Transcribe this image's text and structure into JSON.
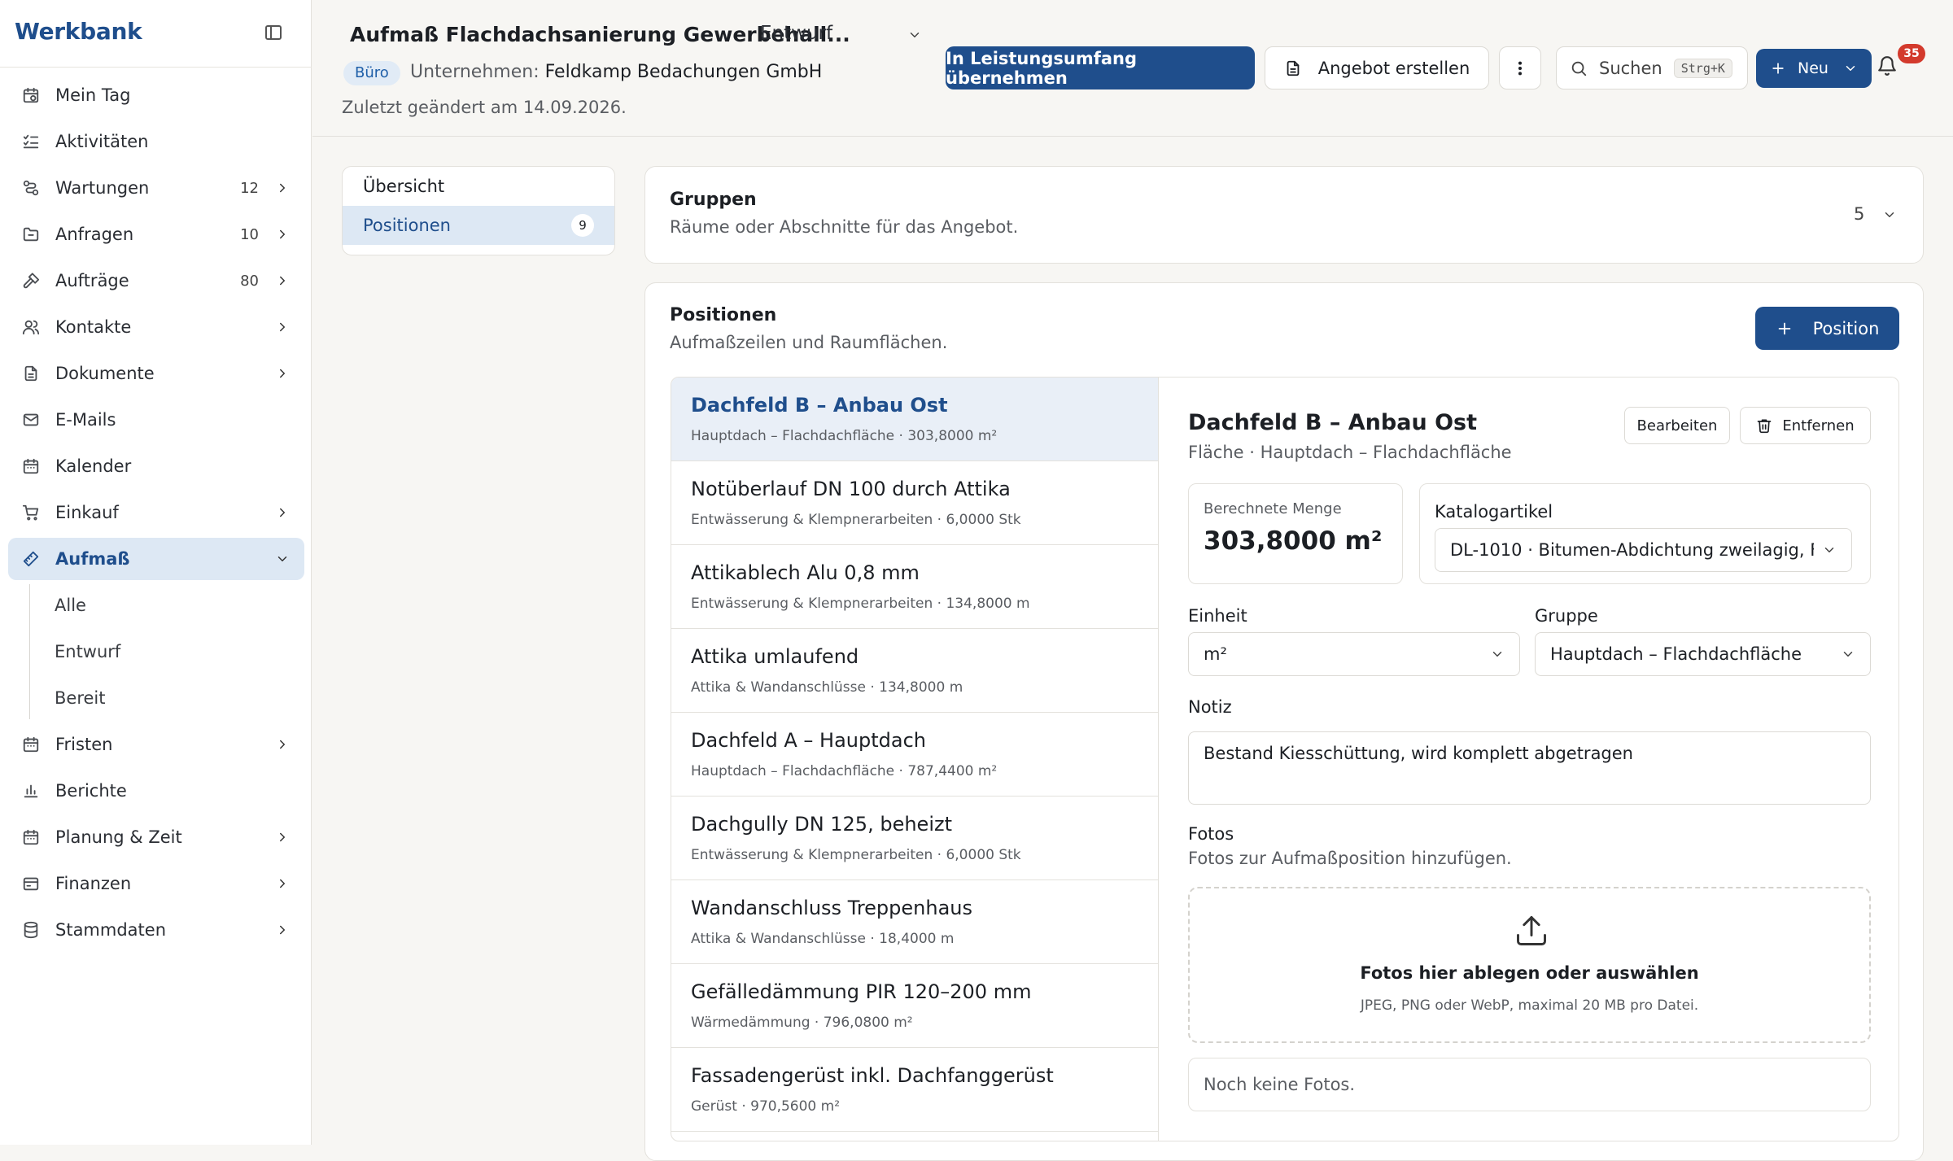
{
  "app": {
    "brand": "Werkbank"
  },
  "sidebar": {
    "items": [
      {
        "label": "Mein Tag",
        "icon": "calendar-clock-icon",
        "count": "",
        "chevron": false
      },
      {
        "label": "Aktivitäten",
        "icon": "list-checks-icon",
        "count": "",
        "chevron": false
      },
      {
        "label": "Wartungen",
        "icon": "route-icon",
        "count": "12",
        "chevron": true
      },
      {
        "label": "Anfragen",
        "icon": "folder-icon",
        "count": "10",
        "chevron": true
      },
      {
        "label": "Aufträge",
        "icon": "hammer-icon",
        "count": "80",
        "chevron": true
      },
      {
        "label": "Kontakte",
        "icon": "users-icon",
        "count": "",
        "chevron": true
      },
      {
        "label": "Dokumente",
        "icon": "document-icon",
        "count": "",
        "chevron": true
      },
      {
        "label": "E-Mails",
        "icon": "mail-icon",
        "count": "",
        "chevron": false
      },
      {
        "label": "Kalender",
        "icon": "calendar-icon",
        "count": "",
        "chevron": false
      },
      {
        "label": "Einkauf",
        "icon": "cart-icon",
        "count": "",
        "chevron": true
      },
      {
        "label": "Aufmaß",
        "icon": "ruler-icon",
        "count": "",
        "chevron": true,
        "active": true
      }
    ],
    "sub_items": [
      {
        "label": "Alle"
      },
      {
        "label": "Entwurf"
      },
      {
        "label": "Bereit"
      }
    ],
    "items_after": [
      {
        "label": "Fristen",
        "icon": "calendar-icon",
        "chevron": true
      },
      {
        "label": "Berichte",
        "icon": "bar-chart-icon",
        "chevron": false
      },
      {
        "label": "Planung & Zeit",
        "icon": "calendar-icon",
        "chevron": true
      },
      {
        "label": "Finanzen",
        "icon": "wallet-icon",
        "chevron": true
      },
      {
        "label": "Stammdaten",
        "icon": "database-icon",
        "chevron": true
      }
    ]
  },
  "header": {
    "title": "Aufmaß Flachdachsanierung Gewerbehall...",
    "status": "Entwurf",
    "badge": "Büro",
    "company_label": "Unternehmen:",
    "company_name": "Feldkamp Bedachungen GmbH",
    "changed": "Zuletzt geändert am 14.09.2026.",
    "btn_apply": "In Leistungsumfang übernehmen",
    "btn_offer": "Angebot erstellen",
    "search_label": "Suchen",
    "search_kbd": "Strg+K",
    "btn_new": "Neu",
    "notifications": "35"
  },
  "tabs": [
    {
      "label": "Übersicht",
      "count": ""
    },
    {
      "label": "Positionen",
      "count": "9"
    }
  ],
  "groups": {
    "title": "Gruppen",
    "subtitle": "Räume oder Abschnitte für das Angebot.",
    "count": "5"
  },
  "positions": {
    "title": "Positionen",
    "subtitle": "Aufmaßzeilen und Raumflächen.",
    "add_label": "Position",
    "items": [
      {
        "title": "Dachfeld B – Anbau Ost",
        "meta": "Hauptdach – Flachdachfläche · 303,8000 m²"
      },
      {
        "title": "Notüberlauf DN 100 durch Attika",
        "meta": "Entwässerung & Klempnerarbeiten · 6,0000 Stk"
      },
      {
        "title": "Attikablech Alu 0,8 mm",
        "meta": "Entwässerung & Klempnerarbeiten · 134,8000 m"
      },
      {
        "title": "Attika umlaufend",
        "meta": "Attika & Wandanschlüsse · 134,8000 m"
      },
      {
        "title": "Dachfeld A – Hauptdach",
        "meta": "Hauptdach – Flachdachfläche · 787,4400 m²"
      },
      {
        "title": "Dachgully DN 125, beheizt",
        "meta": "Entwässerung & Klempnerarbeiten · 6,0000 Stk"
      },
      {
        "title": "Wandanschluss Treppenhaus",
        "meta": "Attika & Wandanschlüsse · 18,4000 m"
      },
      {
        "title": "Gefälledämmung PIR 120–200 mm",
        "meta": "Wärmedämmung · 796,0800 m²"
      },
      {
        "title": "Fassadengerüst inkl. Dachfanggerüst",
        "meta": "Gerüst · 970,5600 m²"
      }
    ]
  },
  "detail": {
    "title": "Dachfeld B – Anbau Ost",
    "subtitle": "Fläche · Hauptdach – Flachdachfläche",
    "btn_edit": "Bearbeiten",
    "btn_remove": "Entfernen",
    "qty_label": "Berechnete Menge",
    "qty_value": "303,8000 m²",
    "catalog_label": "Katalogartikel",
    "catalog_value": "DL-1010 · Bitumen-Abdichtung zweilagig, F...",
    "unit_label": "Einheit",
    "unit_value": "m²",
    "group_label": "Gruppe",
    "group_value": "Hauptdach – Flachdachfläche",
    "note_label": "Notiz",
    "note_value": "Bestand Kiesschüttung, wird komplett abgetragen",
    "photos_label": "Fotos",
    "photos_sub": "Fotos zur Aufmaßposition hinzufügen.",
    "drop_title": "Fotos hier ablegen oder auswählen",
    "drop_sub": "JPEG, PNG oder WebP, maximal 20 MB pro Datei.",
    "no_photos": "Noch keine Fotos."
  },
  "colors": {
    "accent": "#1f4e8c",
    "active_bg": "#dde8f4",
    "badge_red": "#d33a2c"
  }
}
